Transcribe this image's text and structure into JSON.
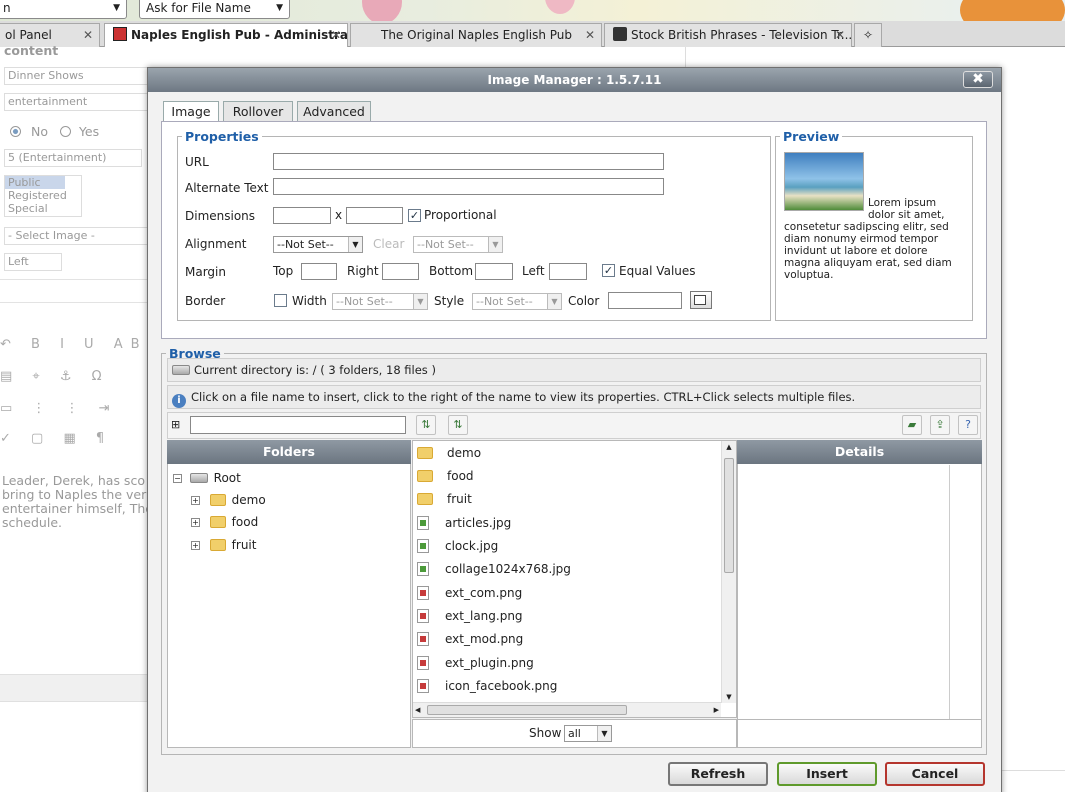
{
  "browser": {
    "combo_left": "n",
    "combo_file": "Ask for File Name",
    "tabs": [
      {
        "label": "ol Panel"
      },
      {
        "label": "Naples English Pub - Administration"
      },
      {
        "label": "The Original Naples English Pub"
      },
      {
        "label": "Stock British Phrases - Television Tr..."
      }
    ],
    "new_tab_glyph": "✧"
  },
  "background_page": {
    "section_label": "content",
    "field1": "Dinner Shows",
    "field2": "entertainment",
    "radio_no": "No",
    "radio_yes": "Yes",
    "category": "5 (Entertainment)",
    "access": [
      "Public",
      "Registered",
      "Special"
    ],
    "select_image": "- Select Image -",
    "align": "Left",
    "editor_lines": [
      "Leader, Derek, has sco",
      "bring to Naples the ver",
      "entertainer himself, The",
      "schedule."
    ]
  },
  "modal": {
    "title": "Image Manager : 1.5.7.11",
    "close_glyph": "✖",
    "tabs": {
      "image": "Image",
      "rollover": "Rollover",
      "advanced": "Advanced"
    },
    "properties": {
      "legend": "Properties",
      "url_label": "URL",
      "alt_label": "Alternate Text",
      "dimensions_label": "Dimensions",
      "times": "x",
      "proportional": "Proportional",
      "alignment_label": "Alignment",
      "alignment_value": "--Not Set--",
      "clear_label": "Clear",
      "clear_value": "--Not Set--",
      "margin_label": "Margin",
      "top": "Top",
      "right": "Right",
      "bottom": "Bottom",
      "left": "Left",
      "equal_values": "Equal Values",
      "border_label": "Border",
      "width_label": "Width",
      "width_value": "--Not Set--",
      "style_label": "Style",
      "style_value": "--Not Set--",
      "color_label": "Color"
    },
    "preview": {
      "legend": "Preview",
      "text": "Lorem ipsum dolor sit amet, consetetur sadipscing elitr, sed diam nonumy eirmod tempor invidunt ut labore et dolore magna aliquyam erat, sed diam voluptua."
    },
    "browse": {
      "legend": "Browse",
      "current_dir": "Current directory is: / ( 3 folders, 18 files )",
      "info": "Click on a file name to insert, click to the right of the name to view its properties. CTRL+Click selects multiple files.",
      "search_value": "",
      "folders_header": "Folders",
      "details_header": "Details",
      "tree_root": "Root",
      "tree_children": [
        "demo",
        "food",
        "fruit"
      ],
      "files": [
        {
          "name": "demo",
          "kind": "folder"
        },
        {
          "name": "food",
          "kind": "folder"
        },
        {
          "name": "fruit",
          "kind": "folder"
        },
        {
          "name": "articles.jpg",
          "kind": "jpg"
        },
        {
          "name": "clock.jpg",
          "kind": "jpg"
        },
        {
          "name": "collage1024x768.jpg",
          "kind": "jpg"
        },
        {
          "name": "ext_com.png",
          "kind": "png"
        },
        {
          "name": "ext_lang.png",
          "kind": "png"
        },
        {
          "name": "ext_mod.png",
          "kind": "png"
        },
        {
          "name": "ext_plugin.png",
          "kind": "png"
        },
        {
          "name": "icon_facebook.png",
          "kind": "png"
        }
      ],
      "show_label": "Show",
      "show_value": "all"
    },
    "buttons": {
      "refresh": "Refresh",
      "insert": "Insert",
      "cancel": "Cancel"
    },
    "colors": {
      "legend": "#1f5fa8",
      "insert_border": "#5f9a2c",
      "cancel_border": "#b5362e",
      "titlebar": "#7c8691"
    }
  }
}
